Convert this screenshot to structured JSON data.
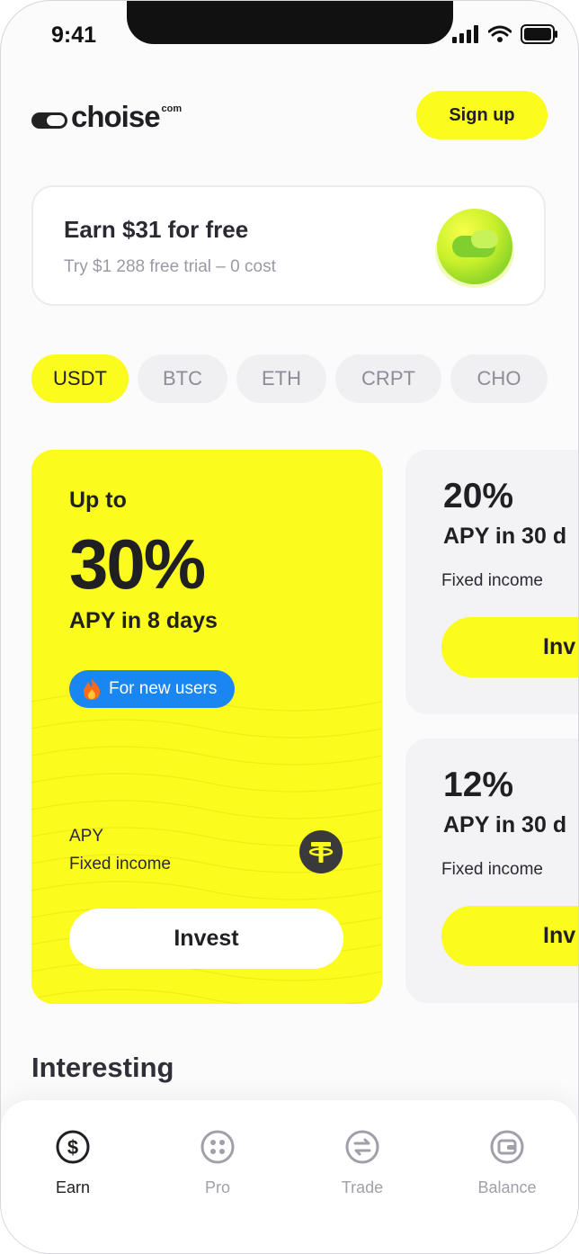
{
  "status_bar": {
    "time": "9:41"
  },
  "header": {
    "logo_text": "choise",
    "logo_suffix": "com",
    "signup_label": "Sign up"
  },
  "promo": {
    "title": "Earn $31 for free",
    "subtitle": "Try $1 288 free trial – 0 cost"
  },
  "tabs": [
    {
      "label": "USDT",
      "active": true
    },
    {
      "label": "BTC"
    },
    {
      "label": "ETH"
    },
    {
      "label": "CRPT"
    },
    {
      "label": "CHO"
    }
  ],
  "main_card": {
    "prefix": "Up to",
    "percent": "30%",
    "apy_text": "APY in 8 days",
    "badge": "For new users",
    "label_apy": "APY",
    "label_income": "Fixed income",
    "invest_label": "Invest",
    "icon": "tether-icon"
  },
  "side_cards": [
    {
      "percent": "20%",
      "apy_text": "APY in 30 d",
      "income": "Fixed income",
      "invest_label": "Inv"
    },
    {
      "percent": "12%",
      "apy_text": "APY in 30 d",
      "income": "Fixed income",
      "invest_label": "Inv"
    }
  ],
  "section": {
    "title": "Interesting"
  },
  "nav": [
    {
      "label": "Earn",
      "icon": "dollar-icon",
      "active": true
    },
    {
      "label": "Pro",
      "icon": "grid-icon"
    },
    {
      "label": "Trade",
      "icon": "exchange-icon"
    },
    {
      "label": "Balance",
      "icon": "wallet-icon"
    }
  ],
  "colors": {
    "accent": "#fbfb1e",
    "badge": "#1a86f2",
    "text": "#1f1f24"
  }
}
